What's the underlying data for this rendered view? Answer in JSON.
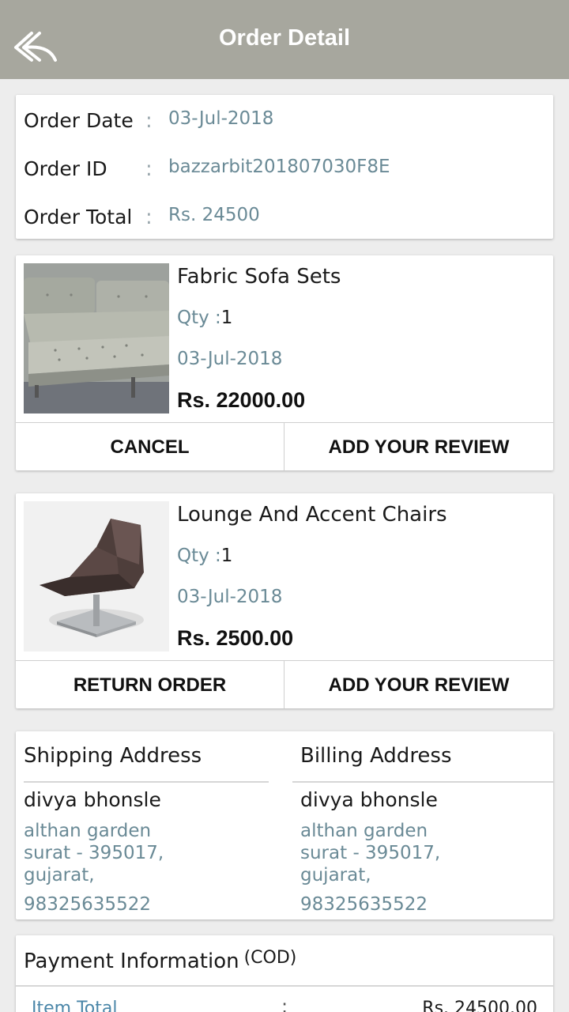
{
  "appbar": {
    "title": "Order Detail",
    "back_icon": "reply-arrow-icon"
  },
  "summary": {
    "rows": [
      {
        "label": "Order Date",
        "colon": ":",
        "value": "03-Jul-2018"
      },
      {
        "label": "Order ID",
        "colon": ":",
        "value": "bazzarbit201807030F8E"
      },
      {
        "label": "Order Total",
        "colon": ":",
        "value": "Rs. 24500"
      }
    ]
  },
  "products": [
    {
      "name": "Fabric Sofa Sets",
      "qty_label": "Qty :",
      "qty": "1",
      "date": "03-Jul-2018",
      "price": "Rs. 22000.00",
      "image": "fabric-sofa-photo",
      "left_action": "CANCEL",
      "right_action": "ADD YOUR REVIEW"
    },
    {
      "name": "Lounge And Accent Chairs",
      "qty_label": "Qty :",
      "qty": "1",
      "date": "03-Jul-2018",
      "price": "Rs. 2500.00",
      "image": "lounge-chair-photo",
      "left_action": "RETURN ORDER",
      "right_action": "ADD YOUR REVIEW"
    }
  ],
  "shipping": {
    "heading": "Shipping Address",
    "name": "divya bhonsle",
    "line1": "althan garden",
    "line2": "surat - 395017,",
    "line3": "gujarat,",
    "phone": "98325635522"
  },
  "billing": {
    "heading": "Billing Address",
    "name": "divya bhonsle",
    "line1": "althan garden",
    "line2": "surat - 395017,",
    "line3": "gujarat,",
    "phone": "98325635522"
  },
  "payment": {
    "heading": "Payment Information",
    "mode": "(COD)",
    "item_total_label": "Item Total",
    "colon": ":",
    "item_total_value": "Rs. 24500.00"
  },
  "colors": {
    "appbar": "#a7a79e",
    "value_text": "#6a8a96",
    "background": "#ededed"
  }
}
